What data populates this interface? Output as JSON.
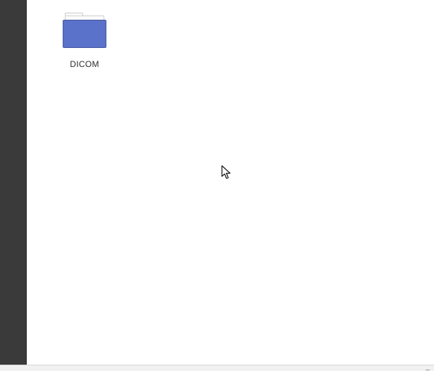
{
  "folder": {
    "name": "DICOM",
    "icon": "folder-icon",
    "color": "#5a72c9"
  },
  "theme": {
    "sidebar_color": "#3a3a3a",
    "background_color": "#ffffff"
  },
  "pointer": {
    "icon": "mouse-pointer-icon"
  }
}
